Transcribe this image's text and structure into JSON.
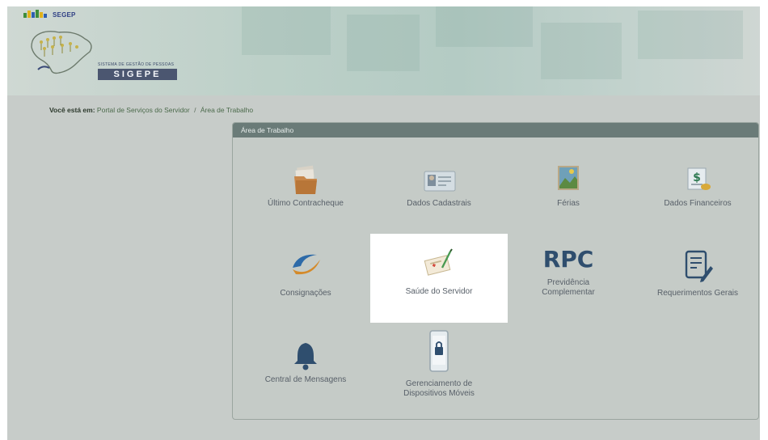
{
  "header": {
    "segep": "SEGEP",
    "sistema": "SISTEMA DE GESTÃO DE PESSOAS",
    "sigepe": "SIGEPE"
  },
  "breadcrumb": {
    "label": "Você está em:",
    "items": [
      "Portal de Serviços do Servidor",
      "Área de Trabalho"
    ],
    "separator": "/"
  },
  "panel": {
    "title": "Área de Trabalho",
    "tiles": [
      {
        "label": "Último Contracheque",
        "icon": "folder-icon"
      },
      {
        "label": "Dados Cadastrais",
        "icon": "id-card-icon"
      },
      {
        "label": "Férias",
        "icon": "landscape-icon"
      },
      {
        "label": "Dados Financeiros",
        "icon": "money-icon"
      },
      {
        "label": "Consignações",
        "icon": "swoosh-icon"
      },
      {
        "label": "Saúde do Servidor",
        "icon": "health-form-icon"
      },
      {
        "label": "Previdência Complementar",
        "icon": "rpc-icon",
        "icon_text": "RPC"
      },
      {
        "label": "Requerimentos Gerais",
        "icon": "document-edit-icon"
      },
      {
        "label": "Central de Mensagens",
        "icon": "bell-icon"
      },
      {
        "label": "Gerenciamento de Dispositivos Móveis",
        "icon": "phone-lock-icon"
      }
    ]
  },
  "colors": {
    "overlay": "#c7ccc9",
    "panel_header": "#6a7b78",
    "sigepe_box": "#4b5670",
    "bell": "#2f4e6e",
    "rpc": "#2f4e6e"
  }
}
